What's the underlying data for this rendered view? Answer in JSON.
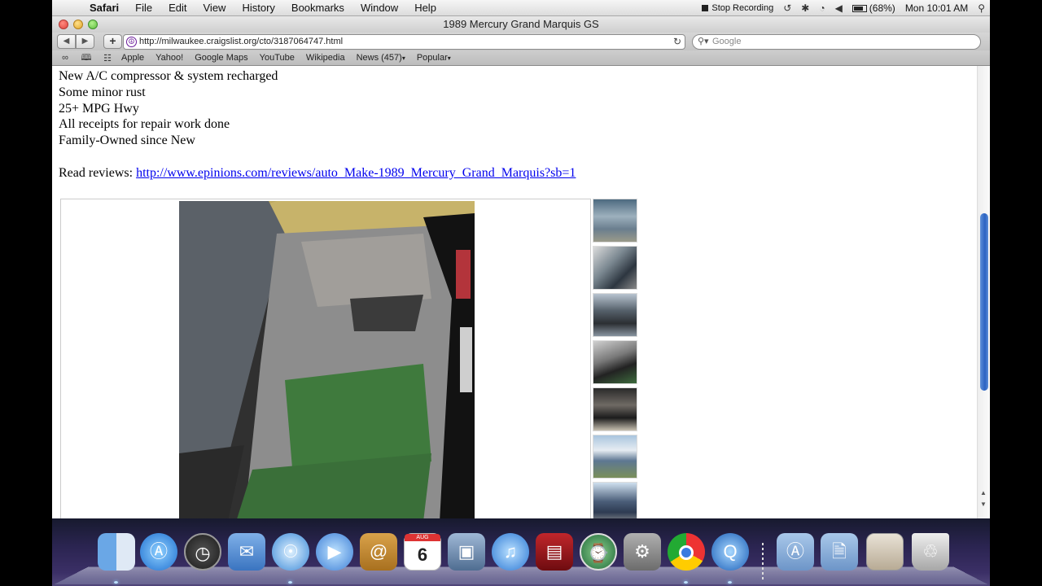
{
  "menubar": {
    "apple_icon": "apple-logo-icon",
    "items": [
      "Safari",
      "File",
      "Edit",
      "View",
      "History",
      "Bookmarks",
      "Window",
      "Help"
    ],
    "stop_recording": "Stop Recording",
    "battery": "(68%)",
    "clock": "Mon 10:01 AM"
  },
  "window": {
    "title": "1989 Mercury Grand Marquis GS",
    "url": "http://milwaukee.craigslist.org/cto/3187064747.html",
    "search_placeholder": "Google",
    "bookmarks": [
      "Apple",
      "Yahoo!",
      "Google Maps",
      "YouTube",
      "Wikipedia",
      "News (457)",
      "Popular"
    ]
  },
  "listing": {
    "lines": [
      "New A/C compressor & system recharged",
      "Some minor rust",
      "25+ MPG Hwy",
      "All receipts for repair work done",
      "Family-Owned since New"
    ],
    "reviews_label": "Read reviews: ",
    "reviews_link": "http://www.epinions.com/reviews/auto_Make-1989_Mercury_Grand_Marquis?sb=1",
    "thumbnail_count": 7
  },
  "dock": {
    "apps": [
      "Finder",
      "App Store",
      "Dashboard",
      "Mail",
      "Safari",
      "FaceTime",
      "Address Book",
      "iCal",
      "iPhoto",
      "iTunes",
      "Photo Booth",
      "Time Machine",
      "System Preferences",
      "Chrome",
      "QuickTime Player",
      "Applications",
      "Documents",
      "Downloads",
      "Trash"
    ],
    "ical_month": "AUG",
    "ical_day": "6"
  }
}
